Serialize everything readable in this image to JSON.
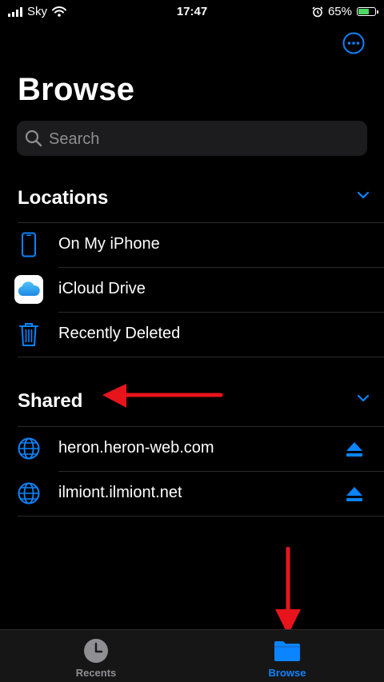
{
  "status_bar": {
    "carrier": "Sky",
    "time": "17:47",
    "battery_percent": "65%",
    "battery_level": 0.65,
    "icons": [
      "signal-icon",
      "wifi-icon",
      "alarm-icon",
      "battery-charging-icon"
    ]
  },
  "header": {
    "title": "Browse",
    "more_icon": "ellipsis-circle-icon"
  },
  "search": {
    "placeholder": "Search",
    "value": ""
  },
  "locations": {
    "title": "Locations",
    "items": [
      {
        "label": "On My iPhone",
        "icon": "iphone-icon"
      },
      {
        "label": "iCloud Drive",
        "icon": "icloud-icon"
      },
      {
        "label": "Recently Deleted",
        "icon": "trash-icon"
      }
    ]
  },
  "shared": {
    "title": "Shared",
    "items": [
      {
        "label": "heron.heron-web.com",
        "icon": "globe-icon",
        "action_icon": "eject-icon"
      },
      {
        "label": "ilmiont.ilmiont.net",
        "icon": "globe-icon",
        "action_icon": "eject-icon"
      }
    ]
  },
  "tab_bar": {
    "tabs": [
      {
        "label": "Recents",
        "icon": "clock-icon",
        "selected": false
      },
      {
        "label": "Browse",
        "icon": "folder-icon",
        "selected": true
      }
    ]
  },
  "colors": {
    "accent": "#0a84ff",
    "annotation_arrow": "#e8141c",
    "background": "#000000",
    "search_background": "#1c1c1e"
  }
}
